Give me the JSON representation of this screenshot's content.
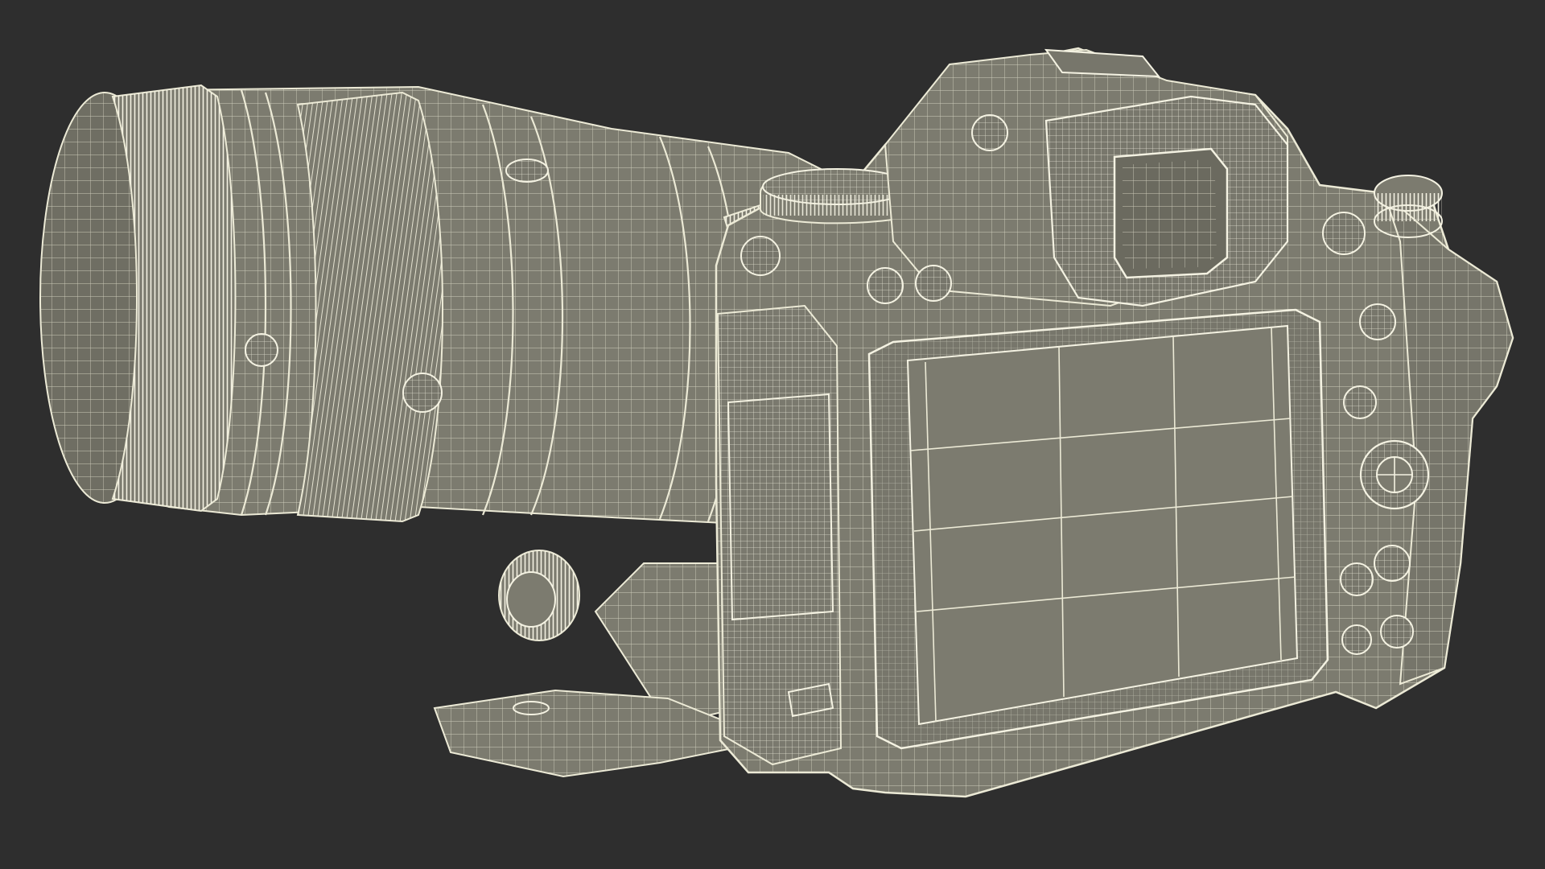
{
  "scene": {
    "subject": "camera-with-telephoto-lens-wireframe",
    "render_style": "wireframe",
    "colors": {
      "background": "#2e2e2e",
      "surface": "#7c7b6f",
      "surface_dark": "#6c6b60",
      "surface_light": "#8a897d",
      "wire": "#ecead6",
      "wire_dense": "#f4f2e2"
    }
  }
}
